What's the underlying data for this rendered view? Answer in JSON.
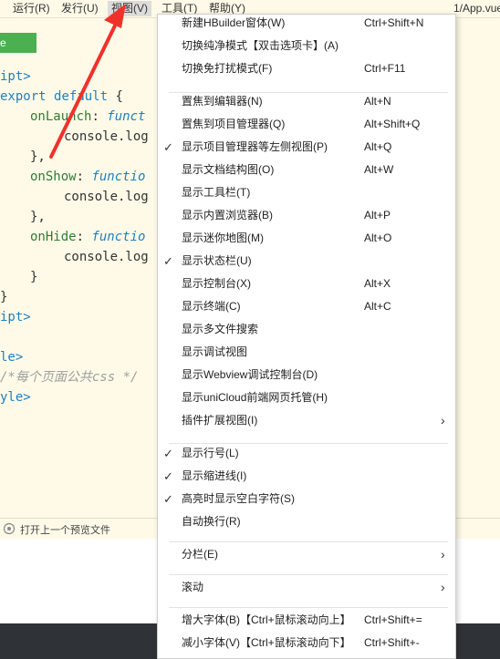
{
  "menubar": {
    "items": [
      "运行(R)",
      "发行(U)",
      "视图(V)",
      "工具(T)",
      "帮助(Y)"
    ],
    "file_path": "1/App.vue"
  },
  "editor": {
    "tab_label": "e",
    "lines": {
      "l1": "ipt>",
      "l2a": "export ",
      "l2b": "default",
      "l2c": " {",
      "l3a": "onLaunch",
      "l3b": ": ",
      "l3c": "funct",
      "l4": "console.log",
      "l5": "},",
      "l6a": "onShow",
      "l6b": ": ",
      "l6c": "functio",
      "l7": "console.log",
      "l8": "},",
      "l9a": "onHide",
      "l9b": ": ",
      "l9c": "functio",
      "l10": "console.log",
      "l11": "}",
      "l12": "}",
      "l13": "ipt>",
      "l14": "le>",
      "l15": "/*每个页面公共css */",
      "l16": "yle>"
    }
  },
  "statusbar": {
    "text": "打开上一个预览文件"
  },
  "menu": {
    "items": [
      {
        "label": "新建HBuilder窗体(W)",
        "shortcut": "Ctrl+Shift+N"
      },
      {
        "label": "切换纯净模式【双击选项卡】(A)",
        "shortcut": ""
      },
      {
        "label": "切换免打扰模式(F)",
        "shortcut": "Ctrl+F11"
      },
      {
        "label": "置焦到编辑器(N)",
        "shortcut": "Alt+N"
      },
      {
        "label": "置焦到项目管理器(Q)",
        "shortcut": "Alt+Shift+Q"
      },
      {
        "label": "显示项目管理器等左侧视图(P)",
        "shortcut": "Alt+Q"
      },
      {
        "label": "显示文档结构图(O)",
        "shortcut": "Alt+W"
      },
      {
        "label": "显示工具栏(T)",
        "shortcut": ""
      },
      {
        "label": "显示内置浏览器(B)",
        "shortcut": "Alt+P"
      },
      {
        "label": "显示迷你地图(M)",
        "shortcut": "Alt+O"
      },
      {
        "label": "显示状态栏(U)",
        "shortcut": ""
      },
      {
        "label": "显示控制台(X)",
        "shortcut": "Alt+X"
      },
      {
        "label": "显示终端(C)",
        "shortcut": "Alt+C"
      },
      {
        "label": "显示多文件搜索",
        "shortcut": ""
      },
      {
        "label": "显示调试视图",
        "shortcut": ""
      },
      {
        "label": "显示Webview调试控制台(D)",
        "shortcut": ""
      },
      {
        "label": "显示uniCloud前端网页托管(H)",
        "shortcut": ""
      },
      {
        "label": "插件扩展视图(I)",
        "shortcut": ""
      },
      {
        "label": "显示行号(L)",
        "shortcut": ""
      },
      {
        "label": "显示缩进线(I)",
        "shortcut": ""
      },
      {
        "label": "高亮时显示空白字符(S)",
        "shortcut": ""
      },
      {
        "label": "自动换行(R)",
        "shortcut": ""
      },
      {
        "label": "分栏(E)",
        "shortcut": ""
      },
      {
        "label": "滚动",
        "shortcut": ""
      },
      {
        "label": "增大字体(B)【Ctrl+鼠标滚动向上】",
        "shortcut": "Ctrl+Shift+="
      },
      {
        "label": "减小字体(V)【Ctrl+鼠标滚动向下】",
        "shortcut": "Ctrl+Shift+-"
      }
    ],
    "check_glyph": "✓",
    "submenu_glyph": "›"
  },
  "colors": {
    "arrow": "#f0312a",
    "accent_green": "#4caf50",
    "editor_bg": "#fffae8"
  }
}
